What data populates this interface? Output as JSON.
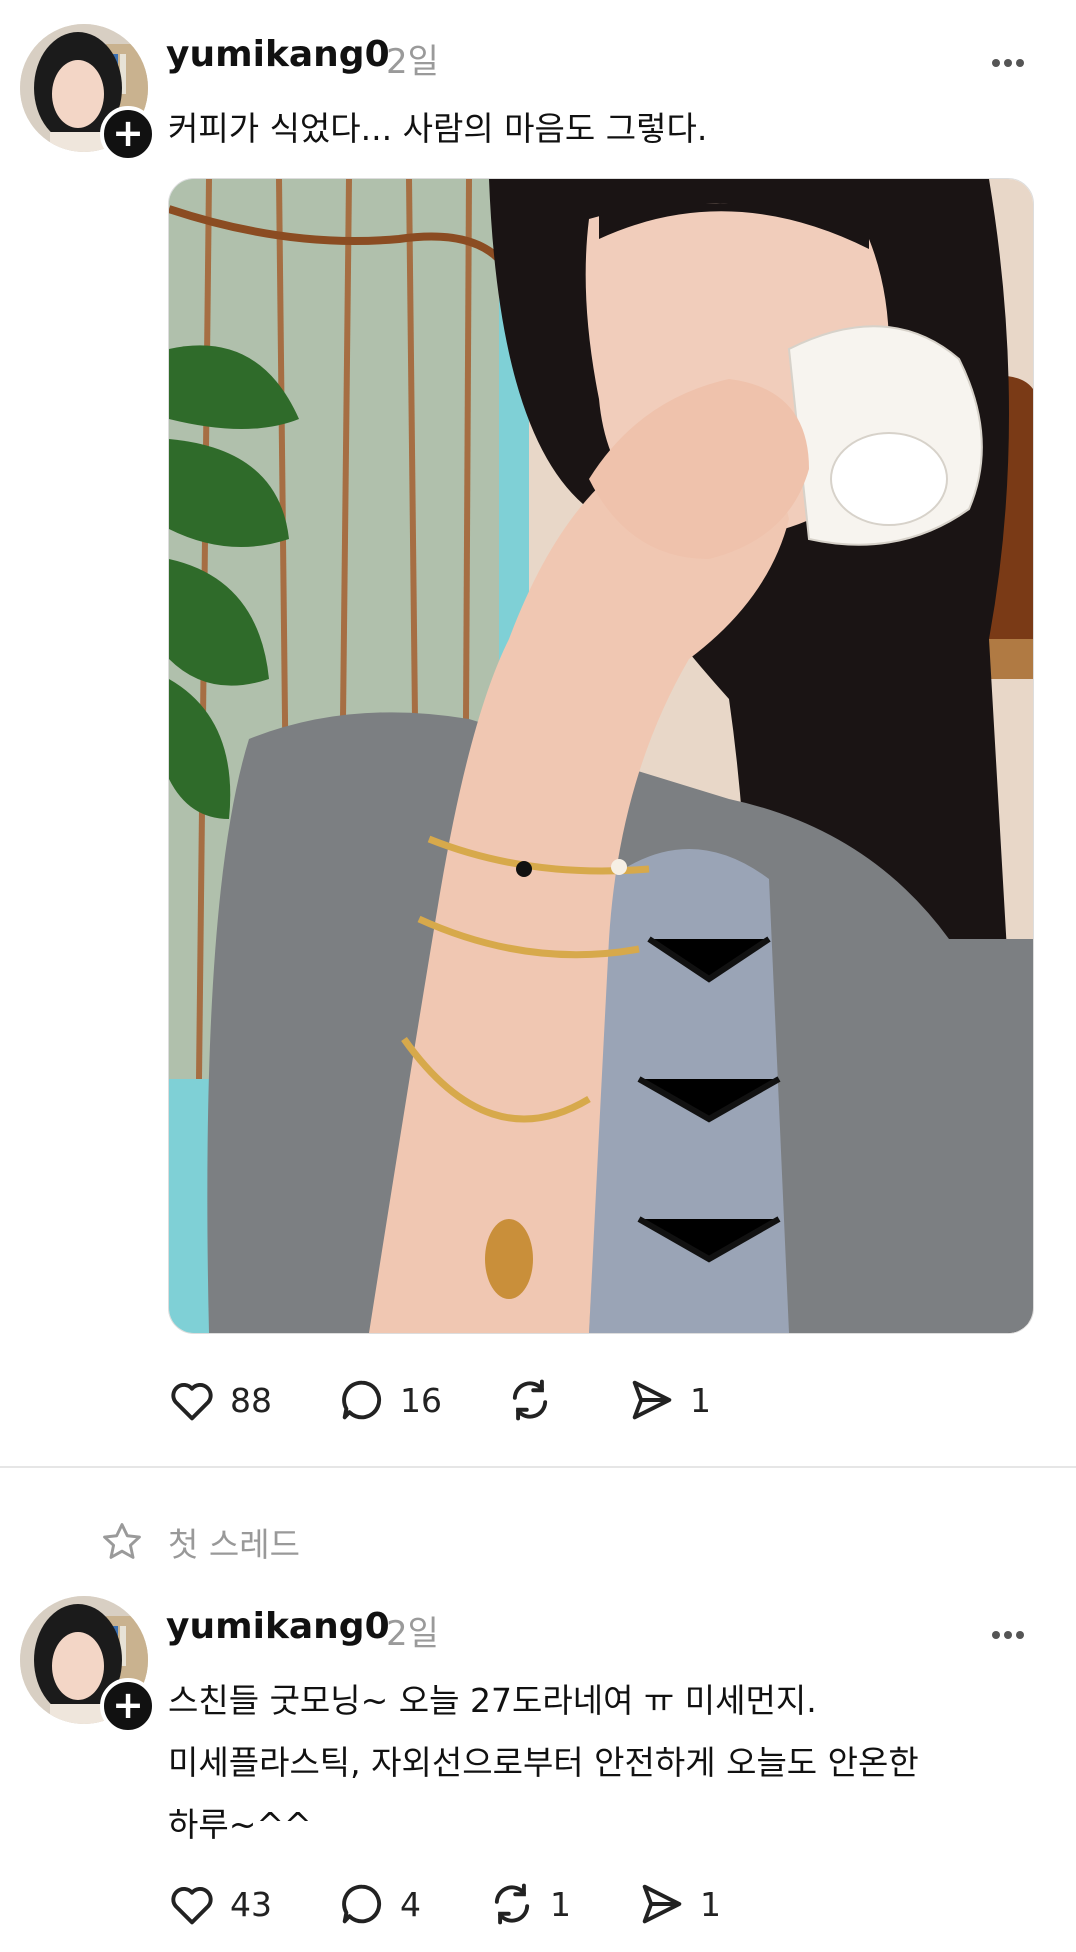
{
  "post1": {
    "username": "yumikang0",
    "time": "2일",
    "text": "커피가 식었다... 사람의 마음도 그렇다.",
    "likes": "88",
    "replies": "16",
    "shares": "1"
  },
  "thread_label": "첫 스레드",
  "post2": {
    "username": "yumikang0",
    "time": "2일",
    "text_line1": "스친들 굿모닝~ 오늘 27도라네여 ㅠ 미세먼지.",
    "text_line2": "미세플라스틱, 자외선으로부터 안전하게 오늘도 안온한",
    "text_line3": "하루~^^",
    "likes": "43",
    "replies": "4",
    "reposts": "1",
    "shares": "1"
  },
  "icons": {
    "add": "plus-icon",
    "more": "more-icon",
    "like": "heart-icon",
    "reply": "comment-icon",
    "repost": "repost-icon",
    "share": "send-icon",
    "thread": "star-icon"
  }
}
